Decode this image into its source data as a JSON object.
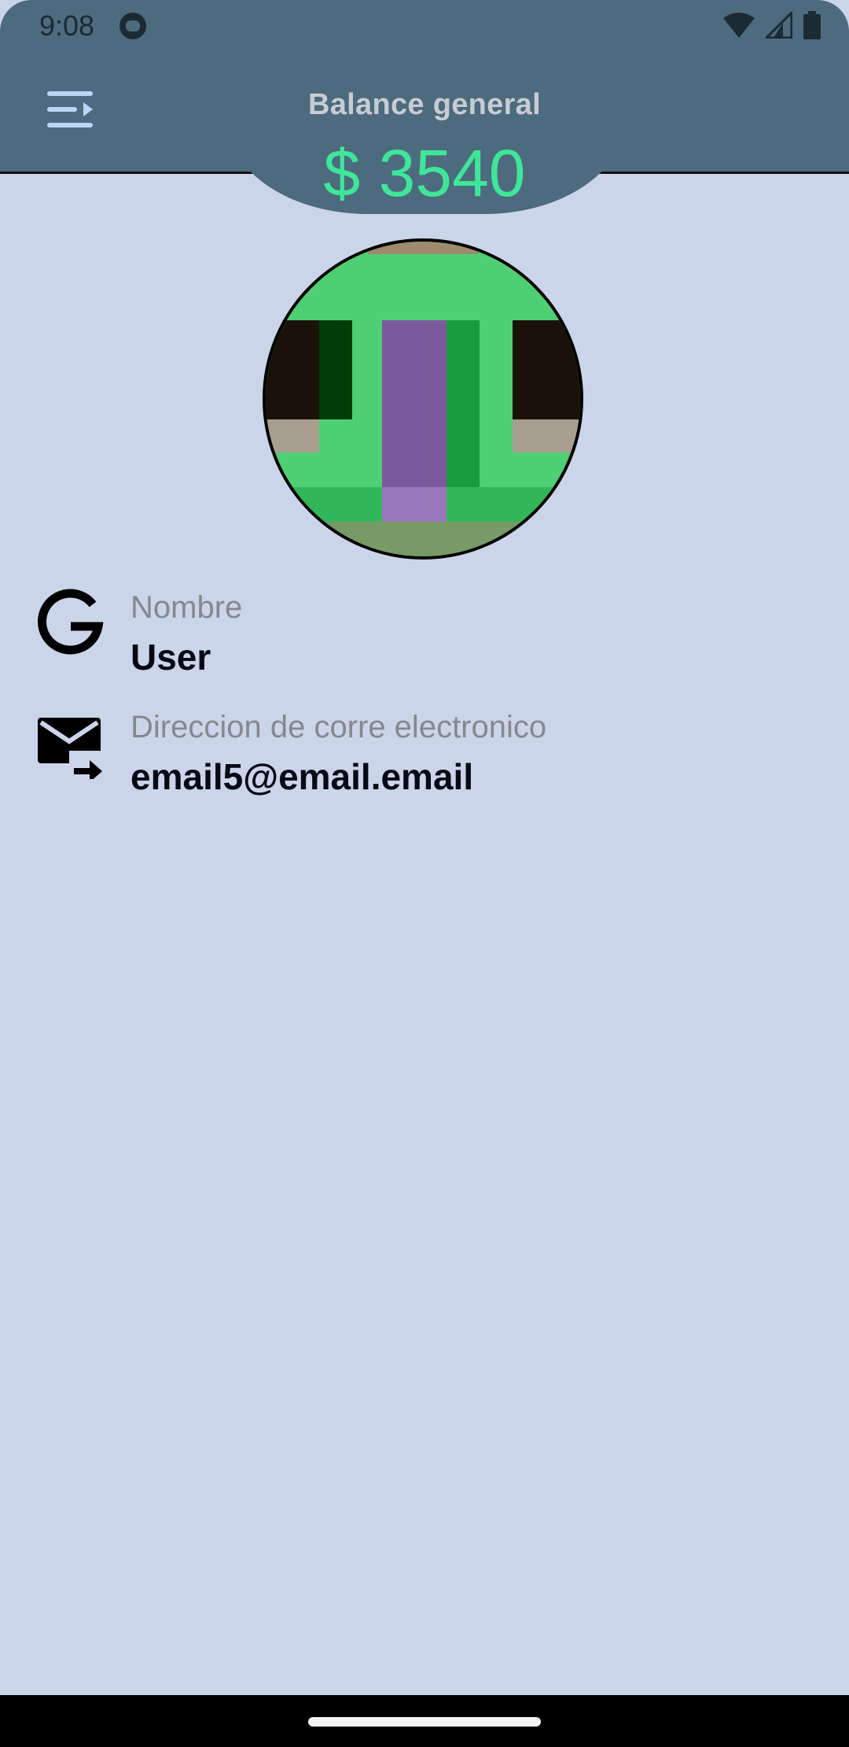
{
  "status_bar": {
    "time": "9:08",
    "icons": [
      "app-notification-icon",
      "wifi-icon",
      "signal-icon",
      "battery-icon"
    ]
  },
  "header": {
    "menu_icon": "menu-arrow-icon",
    "balance_title": "Balance general",
    "balance_amount": "$ 3540",
    "colors": {
      "header_bg": "#4c6b7e",
      "amount": "#3fe69a",
      "page_bg": "#cbd5ea"
    }
  },
  "profile": {
    "avatar_icon": "pixel-avatar",
    "name_label": "Nombre",
    "name_value": "User",
    "name_icon": "google-icon",
    "email_label": "Direccion de corre electronico",
    "email_value": "email5@email.email",
    "email_icon": "mail-forward-icon"
  }
}
